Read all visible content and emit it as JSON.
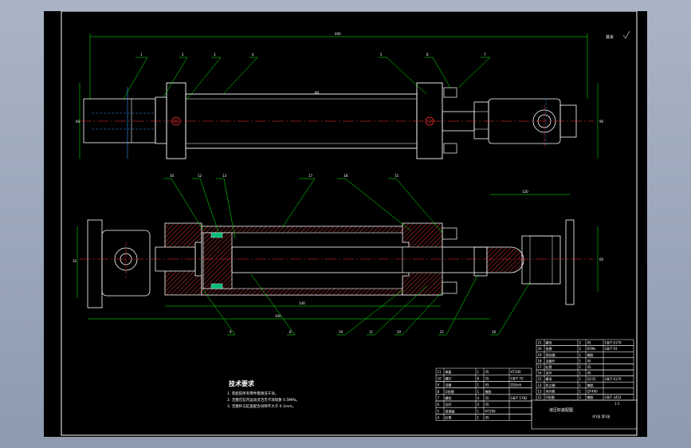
{
  "drawing": {
    "sheet_roughness": "其余",
    "top_overall_dim": "400",
    "top_leader_labels": [
      "1",
      "2",
      "3",
      "4",
      "5",
      "6",
      "7"
    ],
    "top_view_dims": {
      "left_height": "60",
      "right_height": "90",
      "rod": "80"
    },
    "section_leader_labels_top": [
      "10",
      "12",
      "13",
      "17",
      "18",
      "15"
    ],
    "section_leader_labels_bottom": [
      "9",
      "8",
      "19",
      "11",
      "20",
      "21",
      "16"
    ],
    "section_dims": {
      "stroke": "140",
      "overall": "340",
      "right_width": "120",
      "left_height": "32",
      "right_height": "60"
    },
    "tech_requirements": {
      "title": "技术要求",
      "lines": [
        "1. 装配前所有零件需清洗干净。",
        "2. 活塞在缸内运动灵活无卡滞现象 0.5MPa。",
        "3. 活塞杆与缸盖配合间隙不大于 0.1mm。"
      ]
    },
    "title_block": {
      "name": "液压缸装配图",
      "scale": "1:1",
      "sheet": "共1张 第1张"
    },
    "parts_list": {
      "rows": [
        [
          "21",
          "螺母",
          "2",
          "45",
          "GB/T 6170"
        ],
        [
          "20",
          "垫圈",
          "2",
          "65Mn",
          "GB/T 93"
        ],
        [
          "19",
          "密封圈",
          "1",
          "橡胶",
          ""
        ],
        [
          "18",
          "活塞杆",
          "1",
          "45",
          ""
        ],
        [
          "17",
          "缸筒",
          "1",
          "45",
          ""
        ],
        [
          "16",
          "耳环",
          "1",
          "45",
          ""
        ],
        [
          "15",
          "螺母",
          "1",
          "Q235",
          "GB/T 6170"
        ],
        [
          "14",
          "防尘圈",
          "1",
          "橡胶",
          ""
        ],
        [
          "13",
          "导向套",
          "1",
          "QT400",
          ""
        ],
        [
          "12",
          "O形圈",
          "2",
          "橡胶",
          "GB/T 3452"
        ]
      ]
    },
    "lower_table": {
      "rows": [
        [
          "11",
          "端盖",
          "1",
          "45",
          "HT200"
        ],
        [
          "10",
          "螺钉",
          "8",
          "35",
          "GB/T 70"
        ],
        [
          "9",
          "活塞",
          "1",
          "45",
          "ZQSn6"
        ],
        [
          "8",
          "O形圈",
          "1",
          "橡胶",
          ""
        ],
        [
          "7",
          "螺栓",
          "4",
          "35",
          "GB/T 5782"
        ],
        [
          "6",
          "拉杆",
          "4",
          "45",
          ""
        ],
        [
          "5",
          "前端盖",
          "1",
          "HT200",
          ""
        ],
        [
          "4",
          "缸筒",
          "1",
          "45",
          ""
        ]
      ]
    }
  }
}
